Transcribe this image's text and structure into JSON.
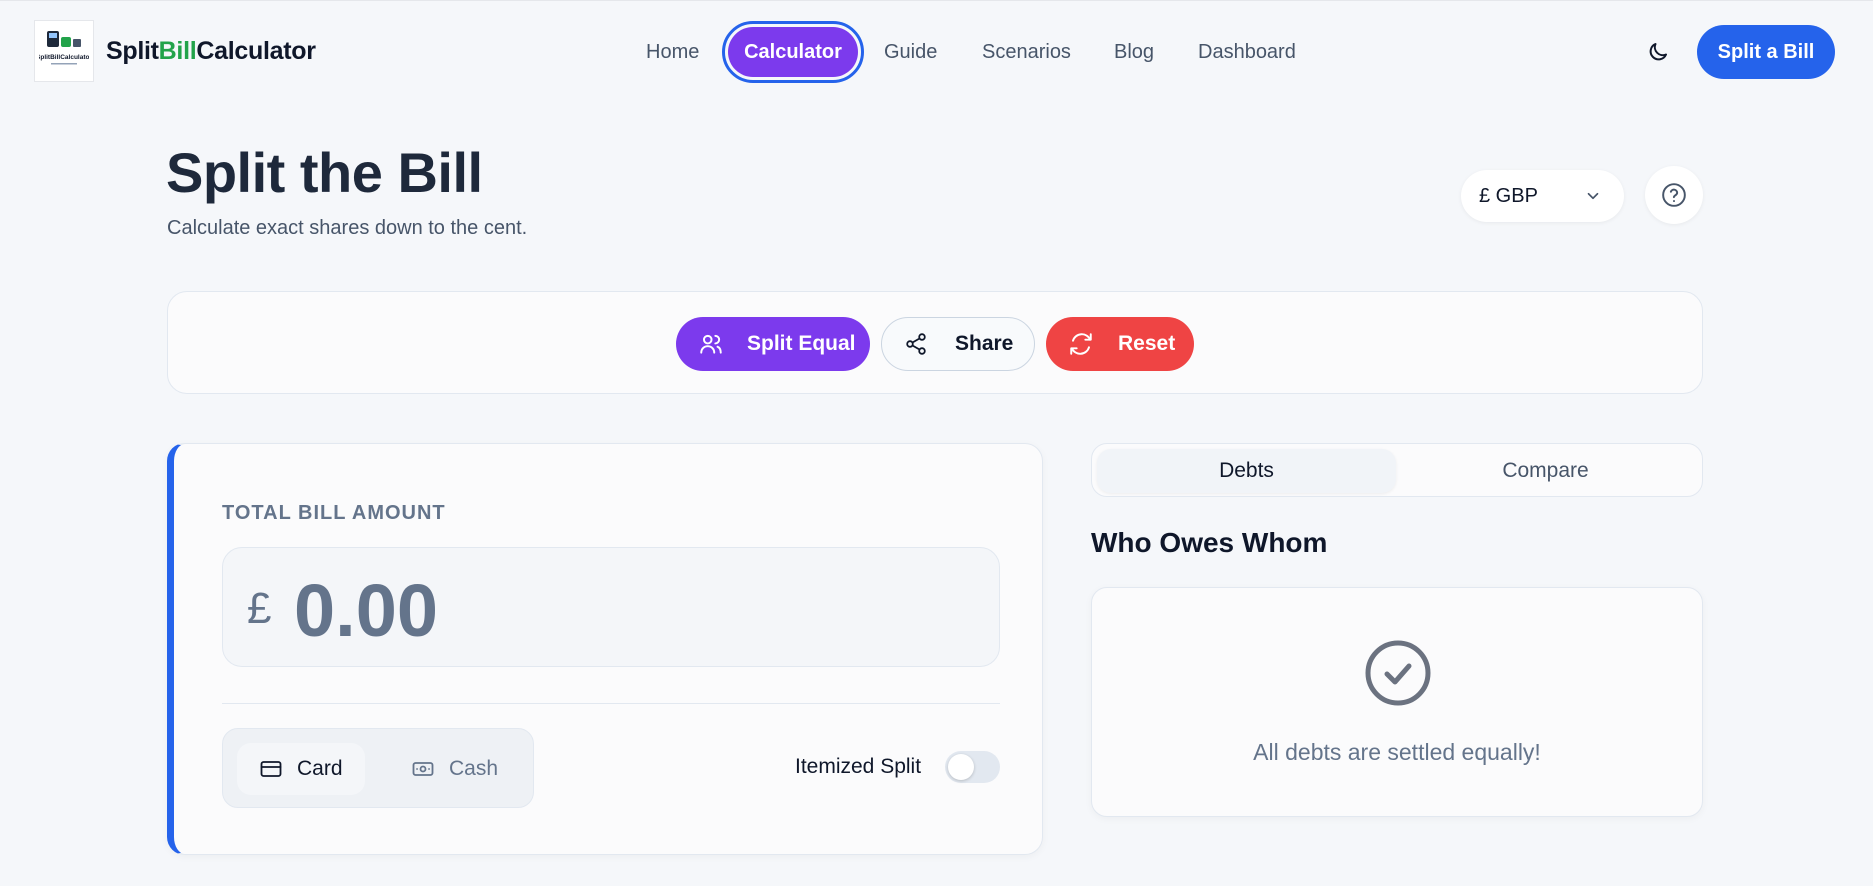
{
  "header": {
    "brand_part1": "Split",
    "brand_part2": "Bill",
    "brand_part3": "Calculator",
    "nav": [
      {
        "label": "Home"
      },
      {
        "label": "Calculator"
      },
      {
        "label": "Guide"
      },
      {
        "label": "Scenarios"
      },
      {
        "label": "Blog"
      },
      {
        "label": "Dashboard"
      }
    ],
    "active_nav": "Calculator",
    "theme_icon": "moon-icon",
    "cta_label": "Split a Bill"
  },
  "page": {
    "title": "Split the Bill",
    "subtitle": "Calculate exact shares down to the cent.",
    "currency_selected": "£ GBP",
    "help_icon": "question-circle-icon"
  },
  "toolbar": {
    "split_equal_label": "Split Equal",
    "share_label": "Share",
    "reset_label": "Reset"
  },
  "bill": {
    "label": "TOTAL BILL AMOUNT",
    "currency_symbol": "£",
    "amount": "0.00",
    "payment_methods": [
      {
        "label": "Card",
        "icon": "credit-card-icon"
      },
      {
        "label": "Cash",
        "icon": "cash-icon"
      }
    ],
    "selected_payment": "Card",
    "itemized_label": "Itemized Split",
    "itemized_enabled": false
  },
  "results": {
    "tabs": [
      {
        "label": "Debts"
      },
      {
        "label": "Compare"
      }
    ],
    "active_tab": "Debts",
    "title": "Who Owes Whom",
    "empty_message": "All debts are settled equally!"
  },
  "colors": {
    "primary_purple": "#7c3aed",
    "primary_blue": "#2563eb",
    "danger_red": "#ef4444",
    "brand_green": "#22a34a"
  }
}
